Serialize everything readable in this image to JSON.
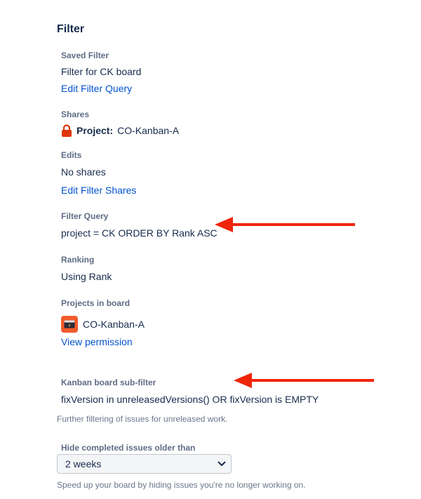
{
  "filter": {
    "section_title": "Filter",
    "saved_filter_label": "Saved Filter",
    "saved_filter_value": "Filter for CK board",
    "edit_filter_query_link": "Edit Filter Query",
    "shares_label": "Shares",
    "shares_prefix": "Project:",
    "shares_project": "CO-Kanban-A",
    "edits_label": "Edits",
    "edits_value": "No shares",
    "edit_filter_shares_link": "Edit Filter Shares",
    "filter_query_label": "Filter Query",
    "filter_query_value": "project = CK ORDER BY Rank ASC",
    "ranking_label": "Ranking",
    "ranking_value": "Using Rank",
    "projects_label": "Projects in board",
    "project_name": "CO-Kanban-A",
    "view_permission_link": "View permission"
  },
  "subfilter": {
    "label": "Kanban board sub-filter",
    "value": "fixVersion in unreleasedVersions() OR fixVersion is EMPTY",
    "help": "Further filtering of issues for unreleased work."
  },
  "hide_completed": {
    "label": "Hide completed issues older than",
    "selected": "2 weeks",
    "help": "Speed up your board by hiding issues you're no longer working on."
  },
  "colors": {
    "accent_link": "#0052cc",
    "annotation_arrow": "#f0250a",
    "lock": "#de350b",
    "project_avatar": "#f15b2a"
  },
  "icons": {
    "lock": "lock-icon",
    "project": "project-avatar-icon",
    "dropdown": "chevron-down-icon"
  }
}
